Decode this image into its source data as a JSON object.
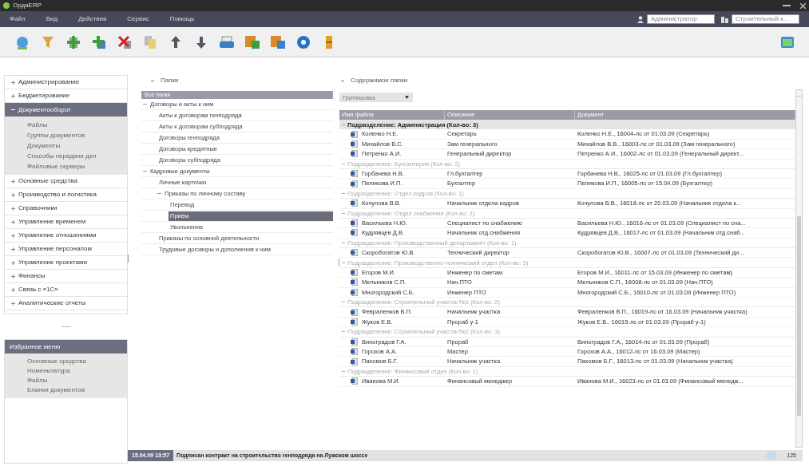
{
  "window": {
    "title": "ОрдаERP"
  },
  "menu": [
    "Файл",
    "Вид",
    "Действия",
    "Сервис",
    "Помощь"
  ],
  "user_select": {
    "value": "Администратор"
  },
  "org_select": {
    "value": "Строительный к..."
  },
  "toolbar": [
    {
      "kind": "globe"
    },
    {
      "kind": "filter"
    },
    {
      "kind": "add"
    },
    {
      "kind": "add2"
    },
    {
      "kind": "delete"
    },
    {
      "kind": "copy"
    },
    {
      "kind": "up"
    },
    {
      "kind": "down"
    },
    {
      "kind": "print"
    },
    {
      "kind": "export"
    },
    {
      "kind": "import"
    },
    {
      "kind": "help"
    },
    {
      "kind": "book"
    }
  ],
  "sidebar": {
    "items": [
      {
        "label": "Администрирование",
        "expanded": false
      },
      {
        "label": "Бюджетирование",
        "expanded": false
      },
      {
        "label": "Документооборот",
        "expanded": true,
        "children": [
          "Файлы",
          "Группы документов",
          "Документы",
          "Способы передачи дел",
          "Файловые серверы"
        ]
      },
      {
        "label": "Основные средства",
        "expanded": false
      },
      {
        "label": "Производство и логистика",
        "expanded": false
      },
      {
        "label": "Справочники",
        "expanded": false
      },
      {
        "label": "Управление временем",
        "expanded": false
      },
      {
        "label": "Управление отношениями",
        "expanded": false
      },
      {
        "label": "Управление персоналом",
        "expanded": false
      },
      {
        "label": "Управление проектами",
        "expanded": false
      },
      {
        "label": "Финансы",
        "expanded": false
      },
      {
        "label": "Связь с «1С»",
        "expanded": false
      },
      {
        "label": "Аналитические отчеты",
        "expanded": false
      }
    ]
  },
  "favorites": {
    "title": "Избранное меню",
    "expanded": true,
    "items": [
      "Основные средства",
      "Номенклатура",
      "Файлы",
      "Бланки документов"
    ]
  },
  "folders": {
    "title": "Папки",
    "header": "Все папки",
    "tree": [
      {
        "label": "Договоры и акты к ним",
        "selected": false,
        "children": [
          {
            "label": "Акты к договорам генподряда",
            "selected": false
          },
          {
            "label": "Акты к договорам субподряда",
            "selected": false
          },
          {
            "label": "Договоры генподряда",
            "selected": false
          },
          {
            "label": "Договоры кредитные",
            "selected": false
          },
          {
            "label": "Договоры субподряда",
            "selected": false
          }
        ]
      },
      {
        "label": "Кадровые документы",
        "selected": false,
        "children": [
          {
            "label": "Личные карточки",
            "selected": false
          },
          {
            "label": "Приказы по личному составу",
            "selected": false,
            "children": [
              {
                "label": "Перевод",
                "selected": false
              },
              {
                "label": "Прием",
                "selected": true
              },
              {
                "label": "Увольнение",
                "selected": false
              }
            ]
          },
          {
            "label": "Приказы по основной деятельности",
            "selected": false
          },
          {
            "label": "Трудовые договоры и дополнения к ним",
            "selected": false
          }
        ]
      }
    ]
  },
  "content": {
    "title": "Содержимое папки",
    "group_select": {
      "placeholder": "Группировка"
    },
    "table": {
      "columns": [
        "Имя файла",
        "Описание",
        "Документ"
      ],
      "groups": [
        {
          "label": "Подразделение: Администрация (Кол-во: 3)",
          "selected": true,
          "rows": [
            [
              "Коленко Н.Е.",
              "Секретарь",
              "Коленко Н.Е., 16004-лс от 01.03.09 (Секретарь)"
            ],
            [
              "Михайлов В.С.",
              "Зам генерального",
              "Михайлов В.В., 16003-лс от 01.03.09 (Зам генерального)"
            ],
            [
              "Петренко А.И.",
              "Генеральный директор",
              "Петренко А.И., 16002-лс от 01.03.09 (Генеральный директ..."
            ]
          ]
        },
        {
          "label": "Подразделение: Бухгалтерия (Кол-во: 2)",
          "selected": false,
          "rows": [
            [
              "Горбачева Н.В.",
              "Гл.бухгалтер",
              "Горбачева Н.В., 16025-лс от 01.03.09 (Гл.бухгалтер)"
            ],
            [
              "Пеликова И.П.",
              "Бухгалтер",
              "Пеликова И.П., 16005-лс от 15.04.09 (Бухгалтер)"
            ]
          ]
        },
        {
          "label": "Подразделение: Отдел кадров (Кол-во: 1)",
          "selected": false,
          "rows": [
            [
              "Кочулова В.В.",
              "Начальник отдела кадров",
              "Кочулова В.В., 16018-лс от 20.03.09 (Начальник отдела к..."
            ]
          ]
        },
        {
          "label": "Подразделение: Отдел снабжения (Кол-во: 2)",
          "selected": false,
          "rows": [
            [
              "Васильева Н.Ю.",
              "Специалист по снабжению",
              "Васильева Н.Ю., 16016-лс от 01.03.09 (Специалист по сна..."
            ],
            [
              "Кудрявцев Д.В.",
              "Начальник отд.снабжения",
              "Кудрявцев Д.В., 16017-лс от 01.03.09 (Начальник отд.снаб..."
            ]
          ]
        },
        {
          "label": "Подразделение: Производственный департамент (Кол-во: 1)",
          "selected": false,
          "rows": [
            [
              "Скоробогатов Ю.В.",
              "Технический директор",
              "Скоробогатов Ю.В., 16007-лс от 01.03.09 (Технический ди..."
            ]
          ]
        },
        {
          "label": "Подразделение: Производственно-технический отдел (Кол-во: 3)",
          "selected": false,
          "rows": [
            [
              "Егоров М.И.",
              "Инженер по сметам",
              "Егоров М.И., 16011-лс от 15.03.09 (Инженер по сметам)"
            ],
            [
              "Мельников С.П.",
              "Нач.ПТО",
              "Мельников С.П., 16008-лс от 01.03.09 (Нач.ПТО)"
            ],
            [
              "Многородский С.Б.",
              "Инженер ПТО",
              "Многородский С.Б., 16010-лс от 01.03.09 (Инженер ПТО)"
            ]
          ]
        },
        {
          "label": "Подразделение: Строительный участок №1 (Кол-во: 2)",
          "selected": false,
          "rows": [
            [
              "Февраленков В.П.",
              "Начальник участка",
              "Февраленков В.П., 16019-лс от 16.03.09 (Начальник участка)"
            ],
            [
              "Жуков Е.В.",
              "Прораб у-1",
              "Жуков Е.В., 16015-лс от 01.03.09 (Прораб у-1)"
            ]
          ]
        },
        {
          "label": "Подразделение: Строительный участок №2 (Кол-во: 3)",
          "selected": false,
          "rows": [
            [
              "Виноградов Г.А.",
              "Прораб",
              "Виноградов Г.А., 16014-лс от 01.03.09 (Прораб)"
            ],
            [
              "Горохов А.А.",
              "Мастер",
              "Горохов А.А., 16012-лс от 16.03.09 (Мастер)"
            ],
            [
              "Пахомов Б.Г.",
              "Начальник участка",
              "Пахомов Б.Г., 16013-лс от 01.03.09 (Начальник участка)"
            ]
          ]
        },
        {
          "label": "Подразделение: Финансовый отдел (Кол-во: 1)",
          "selected": false,
          "rows": [
            [
              "Иванова М.И.",
              "Финансовый менеджер",
              "Иванова М.И., 16023-лс от 01.03.09 (Финансовый менедж..."
            ]
          ]
        }
      ]
    }
  },
  "status_bar": {
    "date": "15.04.09 13:57",
    "message": "Подписан контракт на строительство генподряда на Лужском шоссе",
    "count": "125"
  }
}
